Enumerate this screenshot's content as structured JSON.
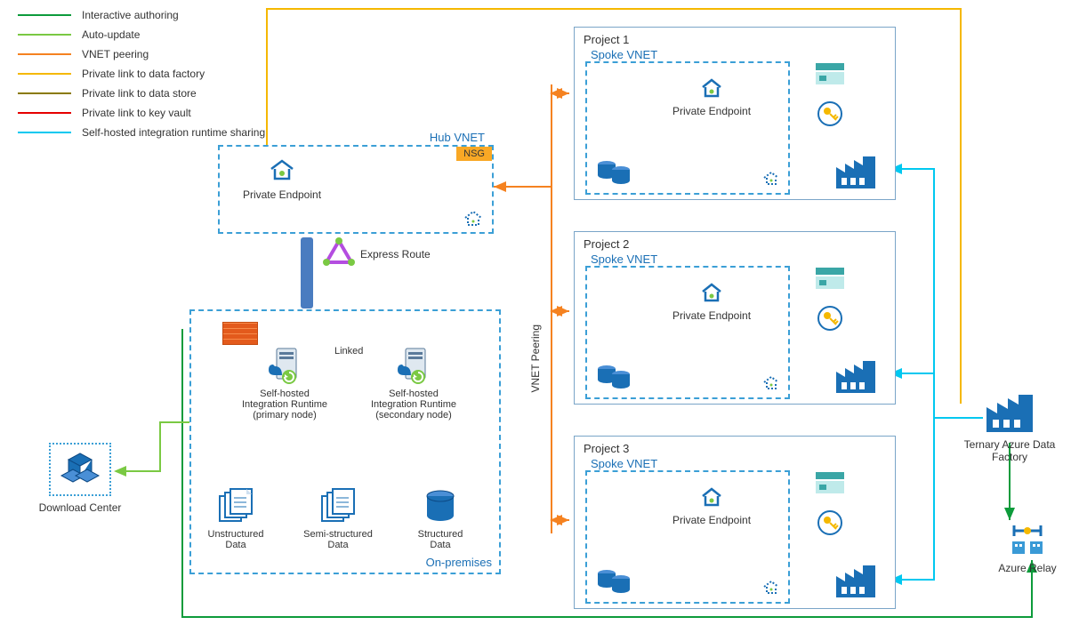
{
  "legend": [
    {
      "color": "#0d9b3b",
      "label": "Interactive authoring"
    },
    {
      "color": "#7ac943",
      "label": "Auto-update"
    },
    {
      "color": "#f58220",
      "label": "VNET peering"
    },
    {
      "color": "#f5b800",
      "label": "Private link to data factory"
    },
    {
      "color": "#8a7a00",
      "label": "Private link to data store"
    },
    {
      "color": "#e60000",
      "label": "Private link to key vault"
    },
    {
      "color": "#00c8f0",
      "label": "Self-hosted integration runtime sharing"
    }
  ],
  "hub": {
    "title": "Hub VNET",
    "nsg": "NSG",
    "pe": "Private Endpoint"
  },
  "er": {
    "label": "Express Route"
  },
  "onprem": {
    "title": "On-premises",
    "linked": "Linked",
    "shir_primary": "Self-hosted\nIntegration Runtime\n(primary node)",
    "shir_secondary": "Self-hosted\nIntegration Runtime\n(secondary node)",
    "unstructured": "Unstructured\nData",
    "semistructured": "Semi-structured\nData",
    "structured": "Structured\nData"
  },
  "download_center": "Download Center",
  "vnet_peering_vert": "VNET Peering",
  "projects": [
    {
      "title": "Project 1",
      "spoke": "Spoke VNET",
      "pe": "Private Endpoint"
    },
    {
      "title": "Project 2",
      "spoke": "Spoke VNET",
      "pe": "Private Endpoint"
    },
    {
      "title": "Project 3",
      "spoke": "Spoke VNET",
      "pe": "Private Endpoint"
    }
  ],
  "ternary_adf": "Ternary Azure Data Factory",
  "azure_relay": "Azure Relay"
}
